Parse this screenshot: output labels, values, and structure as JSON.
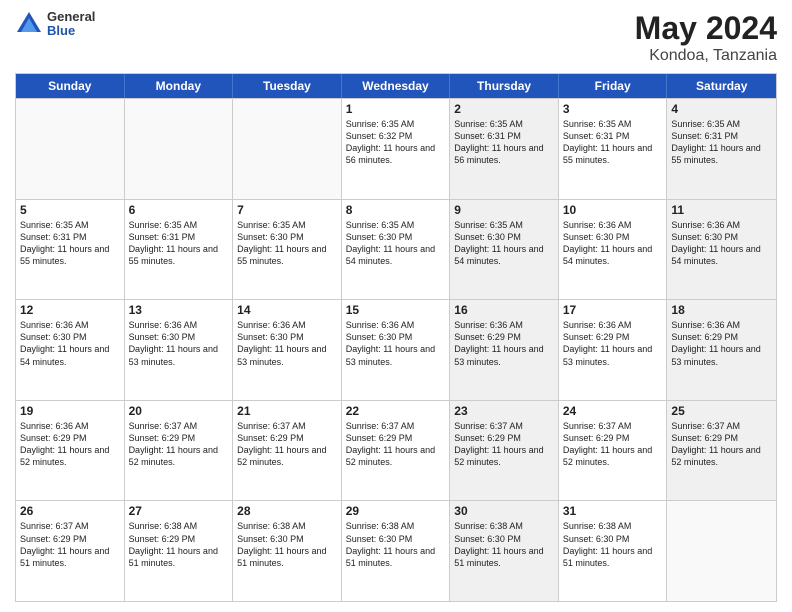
{
  "logo": {
    "general": "General",
    "blue": "Blue"
  },
  "title": {
    "month_year": "May 2024",
    "location": "Kondoa, Tanzania"
  },
  "header_days": [
    "Sunday",
    "Monday",
    "Tuesday",
    "Wednesday",
    "Thursday",
    "Friday",
    "Saturday"
  ],
  "weeks": [
    [
      {
        "day": "",
        "empty": true,
        "shaded": false
      },
      {
        "day": "",
        "empty": true,
        "shaded": false
      },
      {
        "day": "",
        "empty": true,
        "shaded": false
      },
      {
        "day": "1",
        "empty": false,
        "shaded": false,
        "sunrise": "6:35 AM",
        "sunset": "6:32 PM",
        "daylight": "11 hours and 56 minutes."
      },
      {
        "day": "2",
        "empty": false,
        "shaded": true,
        "sunrise": "6:35 AM",
        "sunset": "6:31 PM",
        "daylight": "11 hours and 56 minutes."
      },
      {
        "day": "3",
        "empty": false,
        "shaded": false,
        "sunrise": "6:35 AM",
        "sunset": "6:31 PM",
        "daylight": "11 hours and 55 minutes."
      },
      {
        "day": "4",
        "empty": false,
        "shaded": true,
        "sunrise": "6:35 AM",
        "sunset": "6:31 PM",
        "daylight": "11 hours and 55 minutes."
      }
    ],
    [
      {
        "day": "5",
        "empty": false,
        "shaded": false,
        "sunrise": "6:35 AM",
        "sunset": "6:31 PM",
        "daylight": "11 hours and 55 minutes."
      },
      {
        "day": "6",
        "empty": false,
        "shaded": false,
        "sunrise": "6:35 AM",
        "sunset": "6:31 PM",
        "daylight": "11 hours and 55 minutes."
      },
      {
        "day": "7",
        "empty": false,
        "shaded": false,
        "sunrise": "6:35 AM",
        "sunset": "6:30 PM",
        "daylight": "11 hours and 55 minutes."
      },
      {
        "day": "8",
        "empty": false,
        "shaded": false,
        "sunrise": "6:35 AM",
        "sunset": "6:30 PM",
        "daylight": "11 hours and 54 minutes."
      },
      {
        "day": "9",
        "empty": false,
        "shaded": true,
        "sunrise": "6:35 AM",
        "sunset": "6:30 PM",
        "daylight": "11 hours and 54 minutes."
      },
      {
        "day": "10",
        "empty": false,
        "shaded": false,
        "sunrise": "6:36 AM",
        "sunset": "6:30 PM",
        "daylight": "11 hours and 54 minutes."
      },
      {
        "day": "11",
        "empty": false,
        "shaded": true,
        "sunrise": "6:36 AM",
        "sunset": "6:30 PM",
        "daylight": "11 hours and 54 minutes."
      }
    ],
    [
      {
        "day": "12",
        "empty": false,
        "shaded": false,
        "sunrise": "6:36 AM",
        "sunset": "6:30 PM",
        "daylight": "11 hours and 54 minutes."
      },
      {
        "day": "13",
        "empty": false,
        "shaded": false,
        "sunrise": "6:36 AM",
        "sunset": "6:30 PM",
        "daylight": "11 hours and 53 minutes."
      },
      {
        "day": "14",
        "empty": false,
        "shaded": false,
        "sunrise": "6:36 AM",
        "sunset": "6:30 PM",
        "daylight": "11 hours and 53 minutes."
      },
      {
        "day": "15",
        "empty": false,
        "shaded": false,
        "sunrise": "6:36 AM",
        "sunset": "6:30 PM",
        "daylight": "11 hours and 53 minutes."
      },
      {
        "day": "16",
        "empty": false,
        "shaded": true,
        "sunrise": "6:36 AM",
        "sunset": "6:29 PM",
        "daylight": "11 hours and 53 minutes."
      },
      {
        "day": "17",
        "empty": false,
        "shaded": false,
        "sunrise": "6:36 AM",
        "sunset": "6:29 PM",
        "daylight": "11 hours and 53 minutes."
      },
      {
        "day": "18",
        "empty": false,
        "shaded": true,
        "sunrise": "6:36 AM",
        "sunset": "6:29 PM",
        "daylight": "11 hours and 53 minutes."
      }
    ],
    [
      {
        "day": "19",
        "empty": false,
        "shaded": false,
        "sunrise": "6:36 AM",
        "sunset": "6:29 PM",
        "daylight": "11 hours and 52 minutes."
      },
      {
        "day": "20",
        "empty": false,
        "shaded": false,
        "sunrise": "6:37 AM",
        "sunset": "6:29 PM",
        "daylight": "11 hours and 52 minutes."
      },
      {
        "day": "21",
        "empty": false,
        "shaded": false,
        "sunrise": "6:37 AM",
        "sunset": "6:29 PM",
        "daylight": "11 hours and 52 minutes."
      },
      {
        "day": "22",
        "empty": false,
        "shaded": false,
        "sunrise": "6:37 AM",
        "sunset": "6:29 PM",
        "daylight": "11 hours and 52 minutes."
      },
      {
        "day": "23",
        "empty": false,
        "shaded": true,
        "sunrise": "6:37 AM",
        "sunset": "6:29 PM",
        "daylight": "11 hours and 52 minutes."
      },
      {
        "day": "24",
        "empty": false,
        "shaded": false,
        "sunrise": "6:37 AM",
        "sunset": "6:29 PM",
        "daylight": "11 hours and 52 minutes."
      },
      {
        "day": "25",
        "empty": false,
        "shaded": true,
        "sunrise": "6:37 AM",
        "sunset": "6:29 PM",
        "daylight": "11 hours and 52 minutes."
      }
    ],
    [
      {
        "day": "26",
        "empty": false,
        "shaded": false,
        "sunrise": "6:37 AM",
        "sunset": "6:29 PM",
        "daylight": "11 hours and 51 minutes."
      },
      {
        "day": "27",
        "empty": false,
        "shaded": false,
        "sunrise": "6:38 AM",
        "sunset": "6:29 PM",
        "daylight": "11 hours and 51 minutes."
      },
      {
        "day": "28",
        "empty": false,
        "shaded": false,
        "sunrise": "6:38 AM",
        "sunset": "6:30 PM",
        "daylight": "11 hours and 51 minutes."
      },
      {
        "day": "29",
        "empty": false,
        "shaded": false,
        "sunrise": "6:38 AM",
        "sunset": "6:30 PM",
        "daylight": "11 hours and 51 minutes."
      },
      {
        "day": "30",
        "empty": false,
        "shaded": true,
        "sunrise": "6:38 AM",
        "sunset": "6:30 PM",
        "daylight": "11 hours and 51 minutes."
      },
      {
        "day": "31",
        "empty": false,
        "shaded": false,
        "sunrise": "6:38 AM",
        "sunset": "6:30 PM",
        "daylight": "11 hours and 51 minutes."
      },
      {
        "day": "",
        "empty": true,
        "shaded": false
      }
    ]
  ]
}
